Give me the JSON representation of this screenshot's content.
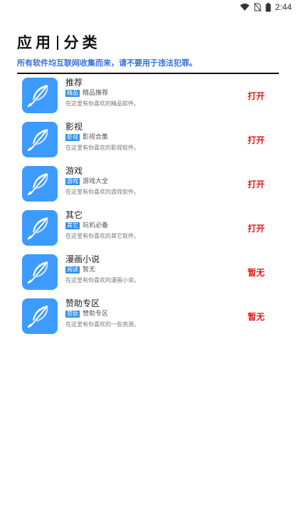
{
  "status_bar": {
    "time": "2:44",
    "icons": [
      "wifi-icon",
      "no-sim-icon",
      "battery-icon"
    ]
  },
  "header": {
    "title_left": "应用",
    "title_right": "分类",
    "disclaimer": "所有软件均互联网收集而来，请不要用于违法犯罪。"
  },
  "colors": {
    "accent": "#3b6fd9",
    "icon_bg": "#3d9bff",
    "tag_bg": "#2e8ee8",
    "action": "#e11b1b"
  },
  "categories": [
    {
      "title": "推荐",
      "tag": "精品",
      "tag_label": "精品推荐",
      "desc": "在这里有你喜欢的精品软件。",
      "action": "打开",
      "icon": "feather-icon"
    },
    {
      "title": "影视",
      "tag": "影视",
      "tag_label": "影视合集",
      "desc": "在这里有你喜欢的影视软件。",
      "action": "打开",
      "icon": "feather-icon"
    },
    {
      "title": "游戏",
      "tag": "游戏",
      "tag_label": "游戏大全",
      "desc": "在这里有你喜欢的游戏软件。",
      "action": "打开",
      "icon": "feather-icon"
    },
    {
      "title": "其它",
      "tag": "其它",
      "tag_label": "玩机必备",
      "desc": "在这里有你喜欢的其它软件。",
      "action": "打开",
      "icon": "feather-icon"
    },
    {
      "title": "漫画小说",
      "tag": "阅读",
      "tag_label": "暂无",
      "desc": "在这里有你喜欢的漫画小说。",
      "action": "暂无",
      "icon": "feather-icon"
    },
    {
      "title": "赞助专区",
      "tag": "赞助",
      "tag_label": "赞助专区",
      "desc": "在这里有你喜欢的一些资源。",
      "action": "暂无",
      "icon": "feather-icon"
    }
  ]
}
